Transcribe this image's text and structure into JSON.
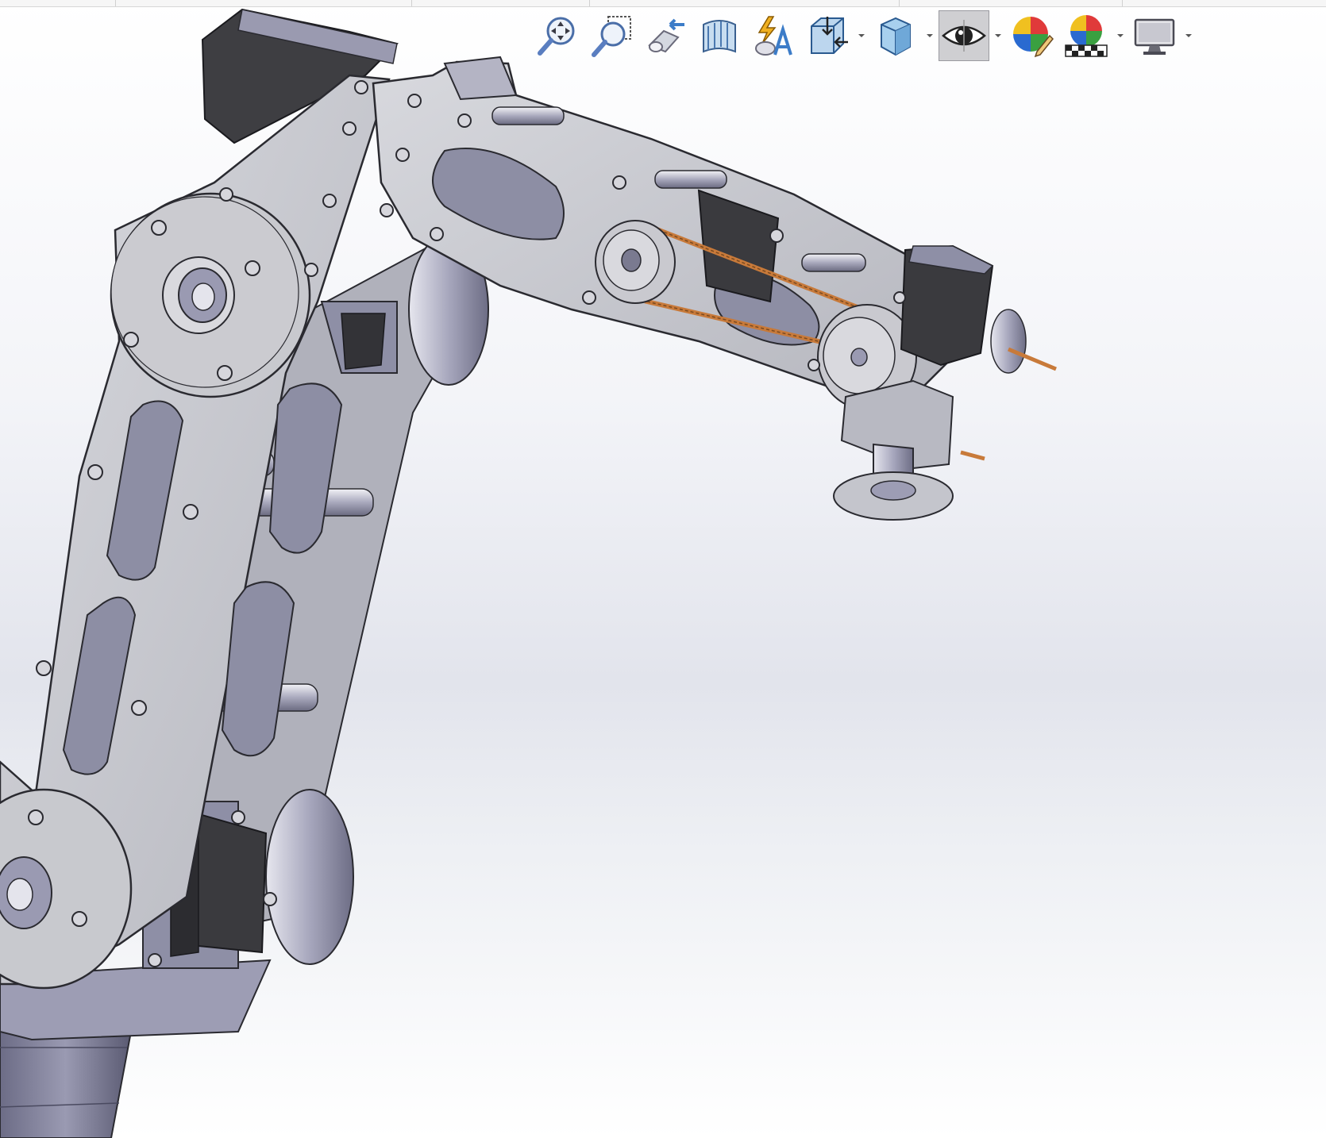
{
  "window": {
    "title": ""
  },
  "toolbar": {
    "items": [
      {
        "name": "zoom-to-fit",
        "icon": "zoom-to-fit-icon",
        "dropdown": false,
        "active": false
      },
      {
        "name": "zoom-to-area",
        "icon": "zoom-to-area-icon",
        "dropdown": false,
        "active": false
      },
      {
        "name": "previous-view",
        "icon": "previous-view-icon",
        "dropdown": false,
        "active": false
      },
      {
        "name": "section-view",
        "icon": "section-view-icon",
        "dropdown": false,
        "active": false
      },
      {
        "name": "dynamic-annotation-views",
        "icon": "dynamic-annotation-icon",
        "dropdown": false,
        "active": false
      },
      {
        "name": "view-orientation",
        "icon": "view-orientation-icon",
        "dropdown": true,
        "active": false
      },
      {
        "name": "display-style",
        "icon": "display-style-icon",
        "dropdown": true,
        "active": false
      },
      {
        "name": "hide-show-items",
        "icon": "hide-show-eye-icon",
        "dropdown": true,
        "active": true
      },
      {
        "name": "edit-appearance",
        "icon": "edit-appearance-icon",
        "dropdown": false,
        "active": false
      },
      {
        "name": "apply-scene",
        "icon": "apply-scene-icon",
        "dropdown": true,
        "active": false
      },
      {
        "name": "view-settings",
        "icon": "view-settings-monitor-icon",
        "dropdown": true,
        "active": false
      }
    ]
  },
  "colors": {
    "metal": "#c4c5ca",
    "metal_dark": "#8e8fa2",
    "edge": "#2a2a30",
    "motor": "#3a3a3e",
    "belt": "#c87a3a",
    "active_bg": "#cfcfd2"
  }
}
